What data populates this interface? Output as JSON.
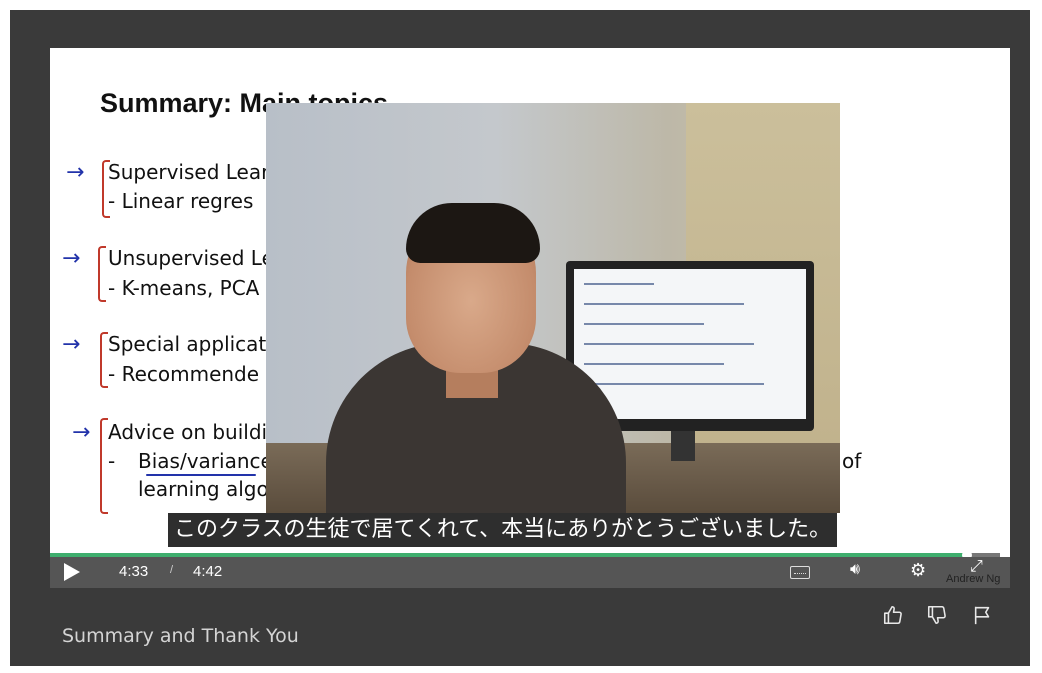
{
  "slide": {
    "title": "Summary: Main topics",
    "items": [
      {
        "heading": "Supervised Lear",
        "sub": "-   Linear regres"
      },
      {
        "heading": "Unsupervised Le",
        "sub": "-   K-means, PCA"
      },
      {
        "heading": "Special applicati",
        "sub": "-   Recommende"
      },
      {
        "heading": "Advice on buildi",
        "sub_prefix": "-   ",
        "sub": "Bias/variance",
        "sub2": "learning algo",
        "trailing": "of"
      }
    ]
  },
  "subtitle": "このクラスの生徒で居てくれて、本当にありがとうございました。",
  "player": {
    "current_time": "4:33",
    "separator": "/",
    "duration": "4:42",
    "progress_fraction": 0.965,
    "watermark": "Andrew Ng",
    "progress_color": "#3fae6e",
    "icons": [
      "play-icon",
      "captions-icon",
      "volume-icon",
      "settings-icon",
      "fullscreen-icon"
    ]
  },
  "lecture": {
    "title": "Summary and Thank You",
    "actions": [
      "thumbs-up-icon",
      "thumbs-down-icon",
      "flag-icon"
    ]
  }
}
